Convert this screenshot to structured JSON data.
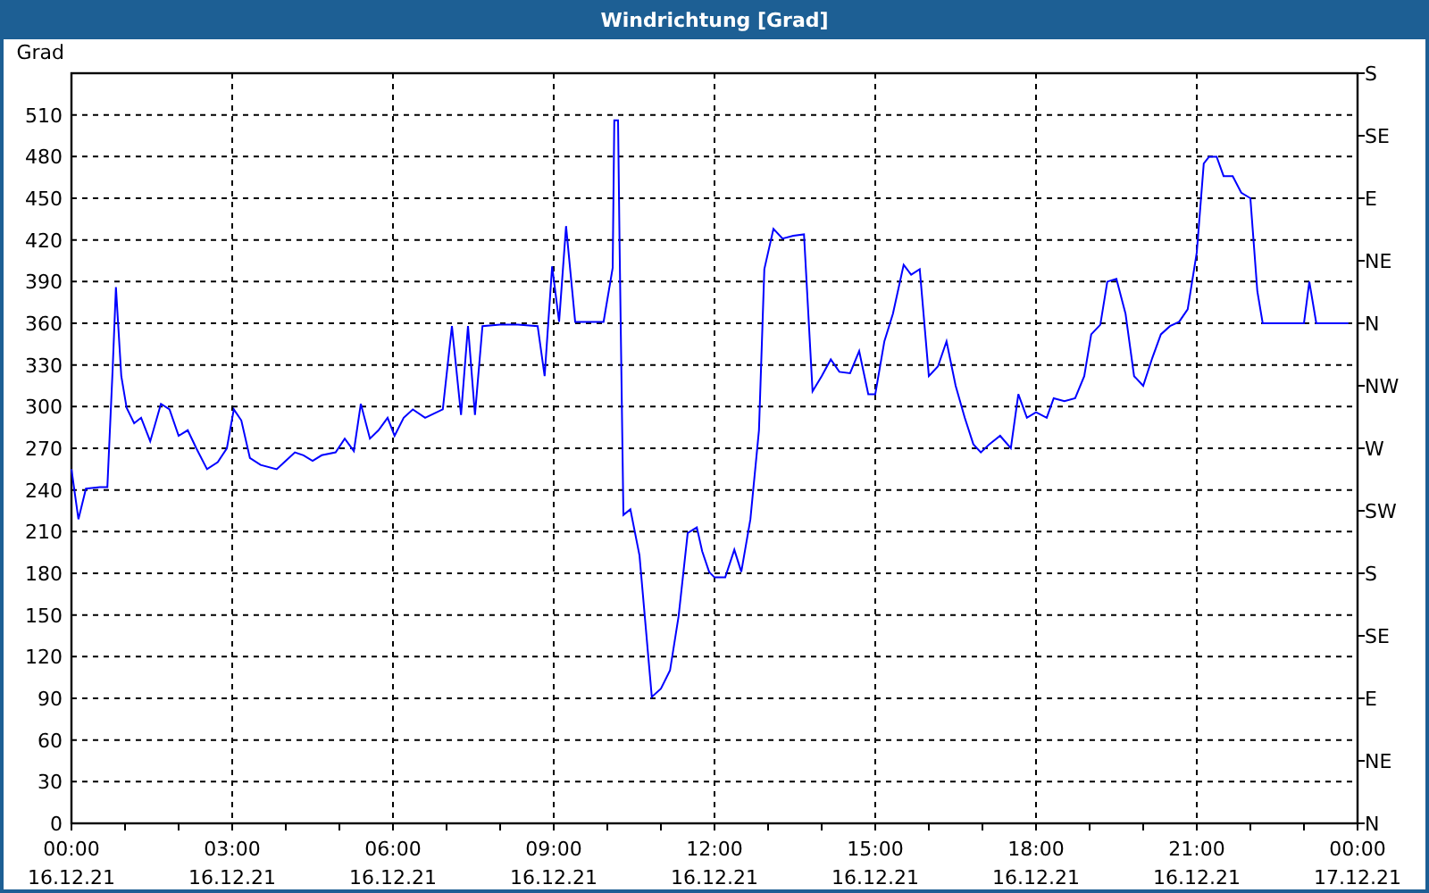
{
  "window": {
    "title": "Windrichtung [Grad]"
  },
  "chart": {
    "chart_data": {
      "type": "line",
      "grid": true,
      "ylabel": "Grad",
      "xlim": [
        0,
        24
      ],
      "ylim": [
        0,
        540
      ],
      "x": [
        0,
        0.13,
        0.27,
        0.53,
        0.67,
        0.77,
        0.83,
        0.93,
        1.03,
        1.17,
        1.3,
        1.47,
        1.67,
        1.83,
        2,
        2.17,
        2.33,
        2.53,
        2.73,
        2.9,
        3.03,
        3.17,
        3.33,
        3.53,
        3.83,
        4,
        4.17,
        4.33,
        4.5,
        4.67,
        4.93,
        5.1,
        5.27,
        5.4,
        5.57,
        5.73,
        5.9,
        6.03,
        6.2,
        6.37,
        6.6,
        6.93,
        7.1,
        7.27,
        7.4,
        7.53,
        7.67,
        8,
        8.33,
        8.7,
        8.83,
        8.97,
        9.1,
        9.23,
        9.4,
        9.93,
        10.1,
        10.13,
        10.2,
        10.23,
        10.3,
        10.43,
        10.6,
        10.83,
        11,
        11.17,
        11.33,
        11.5,
        11.67,
        11.77,
        11.9,
        12,
        12.2,
        12.37,
        12.5,
        12.67,
        12.83,
        12.93,
        13.1,
        13.27,
        13.47,
        13.67,
        13.83,
        14,
        14.17,
        14.33,
        14.53,
        14.7,
        14.87,
        15,
        15.17,
        15.33,
        15.53,
        15.67,
        15.83,
        16,
        16.17,
        16.33,
        16.5,
        16.67,
        16.83,
        16.97,
        17.13,
        17.33,
        17.53,
        17.67,
        17.83,
        18,
        18.2,
        18.33,
        18.53,
        18.73,
        18.9,
        19.03,
        19.2,
        19.33,
        19.5,
        19.67,
        19.83,
        20,
        20.17,
        20.33,
        20.5,
        20.67,
        20.83,
        21,
        21.13,
        21.23,
        21.37,
        21.5,
        21.67,
        21.83,
        22,
        22.13,
        22.23,
        23,
        23.1,
        23.23,
        23.83
      ],
      "series": [
        {
          "color": "#0000ff",
          "values": [
            255,
            219,
            241,
            242,
            242,
            328,
            386,
            322,
            299,
            288,
            292,
            275,
            302,
            298,
            279,
            283,
            270,
            255,
            260,
            270,
            298,
            290,
            263,
            258,
            255,
            261,
            267,
            265,
            261,
            265,
            267,
            277,
            268,
            302,
            277,
            283,
            292,
            279,
            292,
            298,
            292,
            298,
            358,
            294,
            358,
            294,
            358,
            359,
            359,
            358,
            322,
            401,
            361,
            430,
            361,
            361,
            400,
            506,
            506,
            413,
            222,
            226,
            193,
            91,
            97,
            110,
            149,
            209,
            213,
            196,
            181,
            177,
            177,
            197,
            181,
            219,
            283,
            399,
            428,
            421,
            423,
            424,
            311,
            322,
            334,
            325,
            324,
            340,
            309,
            309,
            347,
            367,
            402,
            395,
            399,
            322,
            329,
            347,
            315,
            292,
            273,
            267,
            273,
            279,
            270,
            309,
            292,
            296,
            292,
            306,
            304,
            306,
            322,
            352,
            359,
            390,
            392,
            367,
            322,
            315,
            335,
            352,
            358,
            361,
            370,
            411,
            475,
            480,
            480,
            466,
            466,
            454,
            450,
            383,
            360,
            360,
            390,
            360,
            360
          ]
        }
      ],
      "yticks": [
        0,
        30,
        60,
        90,
        120,
        150,
        180,
        210,
        240,
        270,
        300,
        330,
        360,
        390,
        420,
        450,
        480,
        510
      ],
      "xticks": [
        {
          "value": 0,
          "label": "00:00"
        },
        {
          "value": 3,
          "label": "03:00"
        },
        {
          "value": 6,
          "label": "06:00"
        },
        {
          "value": 9,
          "label": "09:00"
        },
        {
          "value": 12,
          "label": "12:00"
        },
        {
          "value": 15,
          "label": "15:00"
        },
        {
          "value": 18,
          "label": "18:00"
        },
        {
          "value": 21,
          "label": "21:00"
        },
        {
          "value": 24,
          "label": "00:00"
        }
      ]
    },
    "xtick_dates": [
      "16.12.21",
      "16.12.21",
      "16.12.21",
      "16.12.21",
      "16.12.21",
      "16.12.21",
      "16.12.21",
      "16.12.21",
      "17.12.21"
    ],
    "right_axis_ticks": [
      "S",
      "SE",
      "E",
      "NE",
      "N",
      "NW",
      "W",
      "SW",
      "S",
      "SE",
      "E",
      "NE",
      "N"
    ]
  }
}
